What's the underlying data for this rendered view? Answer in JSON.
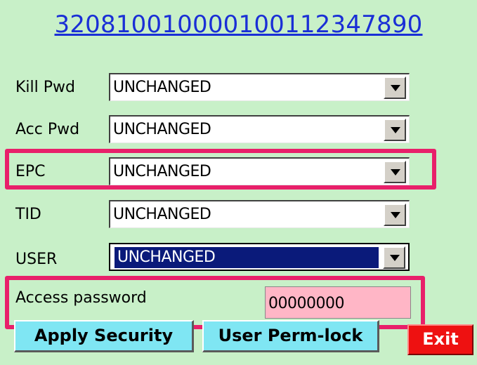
{
  "header": {
    "epc": "320810010000100112347890"
  },
  "rows": [
    {
      "label": "Kill Pwd",
      "value": "UNCHANGED"
    },
    {
      "label": "Acc Pwd",
      "value": "UNCHANGED"
    },
    {
      "label": "EPC",
      "value": "UNCHANGED"
    },
    {
      "label": "TID",
      "value": "UNCHANGED"
    },
    {
      "label": "USER",
      "value": "UNCHANGED"
    }
  ],
  "access": {
    "label": "Access password",
    "value": "00000000"
  },
  "buttons": {
    "apply": "Apply Security",
    "permlock": "User Perm-lock",
    "exit": "Exit"
  },
  "colors": {
    "background": "#c8f0c8",
    "highlight": "#e8206a",
    "link": "#1a2fd6",
    "button_cyan": "#7fe6f3",
    "exit_red": "#ee1111",
    "password_field": "#ffb6c6",
    "focused_select": "#0a1a7a"
  },
  "icons": {
    "dropdown": "chevron-down-icon"
  }
}
